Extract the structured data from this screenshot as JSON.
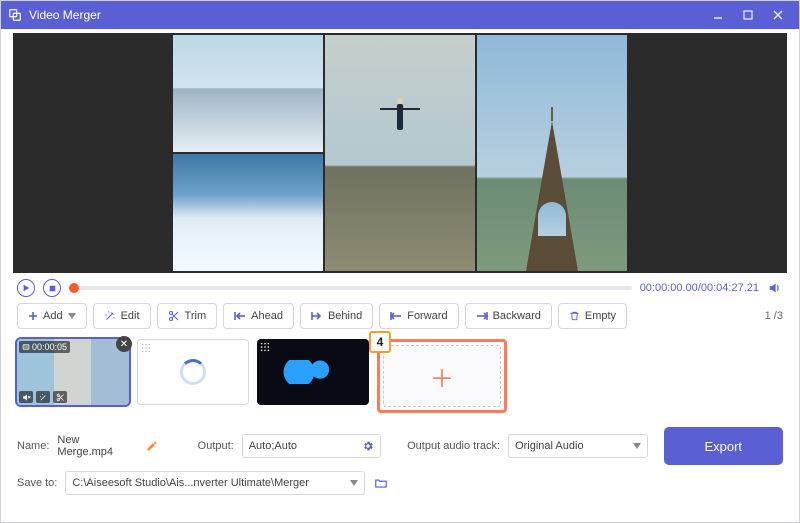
{
  "app": {
    "title": "Video Merger"
  },
  "playbar": {
    "current": "00:00:00.00",
    "total": "00:04:27.21"
  },
  "toolbar": {
    "add": "Add",
    "edit": "Edit",
    "trim": "Trim",
    "ahead": "Ahead",
    "behind": "Behind",
    "forward": "Forward",
    "backward": "Backward",
    "empty": "Empty",
    "page_current": "1",
    "page_total": "3"
  },
  "clips": {
    "c1_duration": "00:00:05"
  },
  "callout": {
    "step": "4"
  },
  "meta": {
    "name_label": "Name:",
    "name_value": "New Merge.mp4",
    "output_label": "Output:",
    "output_value": "Auto;Auto",
    "track_label": "Output audio track:",
    "track_value": "Original Audio",
    "export": "Export"
  },
  "save": {
    "label": "Save to:",
    "path": "C:\\Aiseesoft Studio\\Ais...nverter Ultimate\\Merger"
  }
}
